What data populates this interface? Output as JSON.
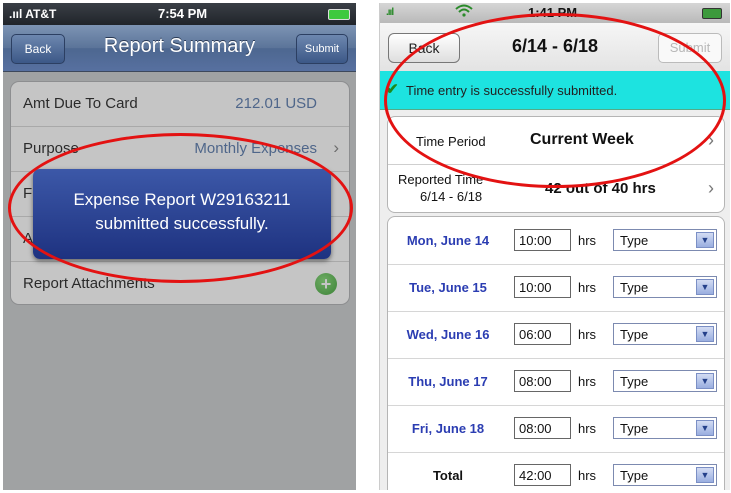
{
  "left_screen": {
    "status_bar": {
      "carrier": ".ııl AT&T",
      "time": "7:54 PM"
    },
    "nav": {
      "back_label": "Back",
      "title": "Report Summary",
      "submit_label": "Submit"
    },
    "rows": [
      {
        "label": "Amt Due To Card",
        "value": "212.01 USD"
      },
      {
        "label": "Purpose",
        "value": "Monthly Expenses"
      },
      {
        "label": "F",
        "value": ""
      },
      {
        "label": "A",
        "value": ""
      },
      {
        "label": "Report Attachments",
        "value": ""
      }
    ],
    "toast": {
      "line1": "Expense Report W29163211",
      "line2": "submitted successfully."
    }
  },
  "right_screen": {
    "status_bar": {
      "signal": ".ııl",
      "time": "1:41 PM"
    },
    "nav": {
      "back_label": "Back",
      "title": "6/14 - 6/18",
      "submit_label": "Submit"
    },
    "banner": "Time entry is successfully submitted.",
    "time_period": {
      "label": "Time Period",
      "value": "Current Week"
    },
    "reported_time": {
      "label_line1": "Reported Time",
      "label_line2": "6/14 - 6/18",
      "value": "42 out of 40 hrs"
    },
    "hrs_label": "hrs",
    "days": [
      {
        "day": "Mon, June 14",
        "hours": "10:00",
        "type": "Type"
      },
      {
        "day": "Tue, June 15",
        "hours": "10:00",
        "type": "Type"
      },
      {
        "day": "Wed, June 16",
        "hours": "06:00",
        "type": "Type"
      },
      {
        "day": "Thu, June 17",
        "hours": "08:00",
        "type": "Type"
      },
      {
        "day": "Fri, June 18",
        "hours": "08:00",
        "type": "Type"
      },
      {
        "day": "Total",
        "hours": "42:00",
        "type": "Type"
      }
    ]
  },
  "colors": {
    "highlight_ellipse": "#e31212",
    "banner": "#1de3e0",
    "toast": "#2a3f95",
    "day_label": "#2b3db2"
  }
}
